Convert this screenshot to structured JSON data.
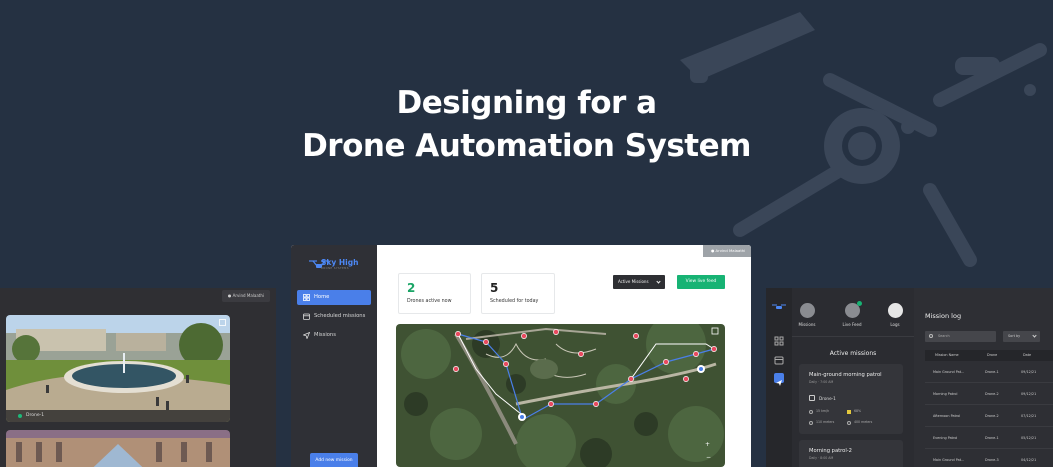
{
  "headline": {
    "line1": "Designing for a",
    "line2": "Drone Automation System"
  },
  "colors": {
    "background": "#253142",
    "accent_blue": "#4a7fe9",
    "accent_green": "#17b374",
    "sidebar": "#2f3036"
  },
  "left_panel": {
    "user": "Arvind Malaathi",
    "feeds": [
      {
        "label": "Drone-1"
      }
    ]
  },
  "app": {
    "brand": "Sky High",
    "brand_sub": "DRONE SYSTEMS",
    "user": "Arvind Malaathi",
    "nav": [
      {
        "label": "Home",
        "icon": "grid-icon",
        "active": true
      },
      {
        "label": "Scheduled missions",
        "icon": "calendar-icon",
        "active": false
      },
      {
        "label": "Missions",
        "icon": "send-icon",
        "active": false
      }
    ],
    "add_mission": "Add new mission",
    "stats": [
      {
        "value": "2",
        "label": "Drones active now"
      },
      {
        "value": "5",
        "label": "Scheduled for today"
      }
    ],
    "filter": {
      "selected": "Active Missions"
    },
    "live_feed_button": "View live feed"
  },
  "right_panel": {
    "tabs": [
      {
        "label": "Missions",
        "icon": "drone-icon"
      },
      {
        "label": "Live Feed",
        "icon": "video-icon"
      },
      {
        "label": "Logs",
        "icon": "document-icon"
      }
    ],
    "active_missions_title": "Active missions",
    "missions": [
      {
        "title": "Main-ground morning patrol",
        "sub": "Daily · 7:00 AM",
        "drone": "Drone-1",
        "speed": "15 km/h",
        "battery": "68%",
        "distance": "110 meters",
        "area": "400 meters"
      },
      {
        "title": "Morning patrol-2",
        "sub": "Daily · 8:00 AM"
      }
    ],
    "mission_log": {
      "title": "Mission log",
      "search_placeholder": "Search",
      "sort_label": "Sort by",
      "columns": [
        "Mission Name",
        "Drone",
        "Date"
      ],
      "rows": [
        [
          "Main Ground Pat...",
          "Drone-1",
          "09/12/21"
        ],
        [
          "Morning Patrol",
          "Drone-2",
          "09/12/21"
        ],
        [
          "Afternoon Patrol",
          "Drone-2",
          "07/12/21"
        ],
        [
          "Evening Patrol",
          "Drone-1",
          "05/12/21"
        ],
        [
          "Main Ground Pat...",
          "Drone-3",
          "04/12/21"
        ]
      ]
    }
  }
}
